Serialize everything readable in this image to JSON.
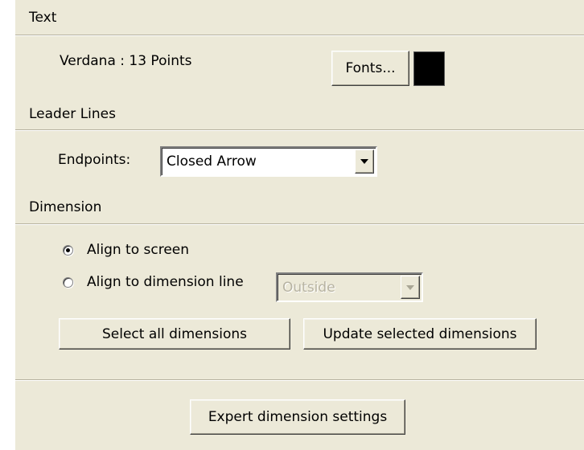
{
  "text_section": {
    "header": "Text",
    "font_description": "Verdana : 13 Points",
    "fonts_button": "Fonts...",
    "color": "#000000"
  },
  "leader_lines": {
    "header": "Leader Lines",
    "endpoints_label": "Endpoints:",
    "endpoints_value": "Closed Arrow"
  },
  "dimension": {
    "header": "Dimension",
    "radio_align_screen": {
      "label": "Align to screen",
      "checked": true
    },
    "radio_align_line": {
      "label": "Align to dimension line",
      "checked": false
    },
    "position_value": "Outside",
    "select_all_button": "Select all dimensions",
    "update_selected_button": "Update selected dimensions"
  },
  "expert_button": "Expert dimension settings"
}
